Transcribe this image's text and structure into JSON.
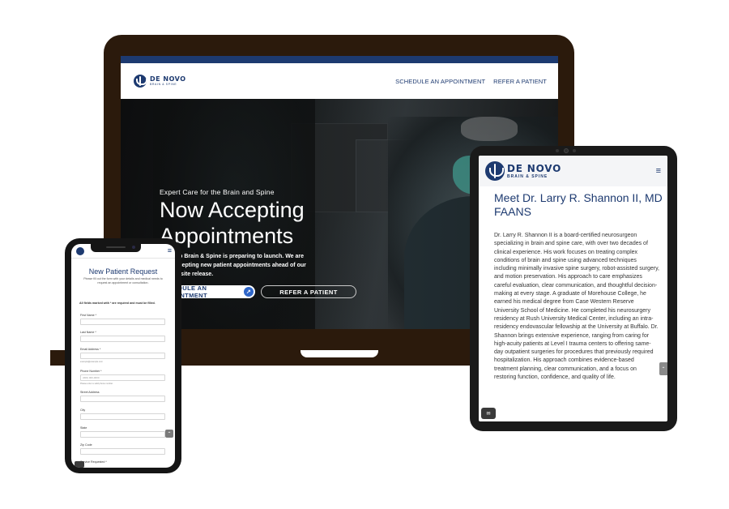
{
  "laptop": {
    "logo": {
      "main": "DE NOVO",
      "sub": "BRAIN & SPINE"
    },
    "nav": [
      "SCHEDULE AN APPOINTMENT",
      "REFER A PATIENT"
    ],
    "hero": {
      "eyebrow": "Expert Care for the Brain and Spine",
      "title_line1": "Now Accepting",
      "title_line2": "Appointments",
      "description": "De Novo Brain & Spine is preparing to launch. We are now accepting new patient appointments ahead of our full website release.",
      "primary_button": "SCHEDULE AN APPOINTMENT",
      "primary_button_icon": "arrow-icon",
      "secondary_button": "REFER A PATIENT"
    }
  },
  "phone": {
    "menu_icon": "hamburger-icon",
    "title": "New Patient Request",
    "subtitle": "Please fill out the form with your details and medical needs to request an appointment or consultation.",
    "note": "All fields marked with * are required and must be filled.",
    "fields": [
      {
        "label": "First Name *",
        "placeholder": "",
        "hint": ""
      },
      {
        "label": "Last Name *",
        "placeholder": "",
        "hint": ""
      },
      {
        "label": "Email Address *",
        "placeholder": "",
        "hint": "example@example.com"
      },
      {
        "label": "Phone Number *",
        "placeholder": "(000) 000-0000",
        "hint": "Please enter a valid phone number."
      },
      {
        "label": "Street Address",
        "placeholder": "",
        "hint": ""
      },
      {
        "label": "City",
        "placeholder": "",
        "hint": ""
      },
      {
        "label": "State",
        "placeholder": "",
        "hint": ""
      },
      {
        "label": "Zip Code",
        "placeholder": "",
        "hint": ""
      },
      {
        "label": "Service Requested *",
        "placeholder": "",
        "hint": ""
      }
    ],
    "scroll_icon": "chevron-up-icon"
  },
  "tablet": {
    "logo": {
      "main": "DE NOVO",
      "sub": "BRAIN & SPINE"
    },
    "menu_icon": "hamburger-icon",
    "heading": "Meet Dr. Larry R. Shannon II, MD FAANS",
    "body": "Dr. Larry R. Shannon II is a board-certified neurosurgeon specializing in brain and spine care, with over two decades of clinical experience. His work focuses on treating complex conditions of brain and spine using advanced techniques including minimally invasive spine surgery, robot-assisted surgery, and motion preservation. His approach to care emphasizes careful evaluation, clear communication, and thoughtful decision-making at every stage. A graduate of Morehouse College, he earned his medical degree from Case Western Reserve University School of Medicine. He completed his neurosurgery residency at Rush University Medical Center, including an intra-residency endovascular fellowship at the University at Buffalo. Dr. Shannon brings extensive experience, ranging from caring for high-acuity patients at Level I trauma centers to offering same-day outpatient surgeries for procedures that previously required hospitalization. His approach combines evidence-based treatment planning, clear communication, and a focus on restoring function, confidence, and quality of life.",
    "scroll_icon": "chevron-up-icon",
    "chat_icon": "chat-icon"
  },
  "colors": {
    "brand_navy": "#1d3a70",
    "accent_blue": "#2f66c8",
    "laptop_frame": "#2b1a0c"
  }
}
